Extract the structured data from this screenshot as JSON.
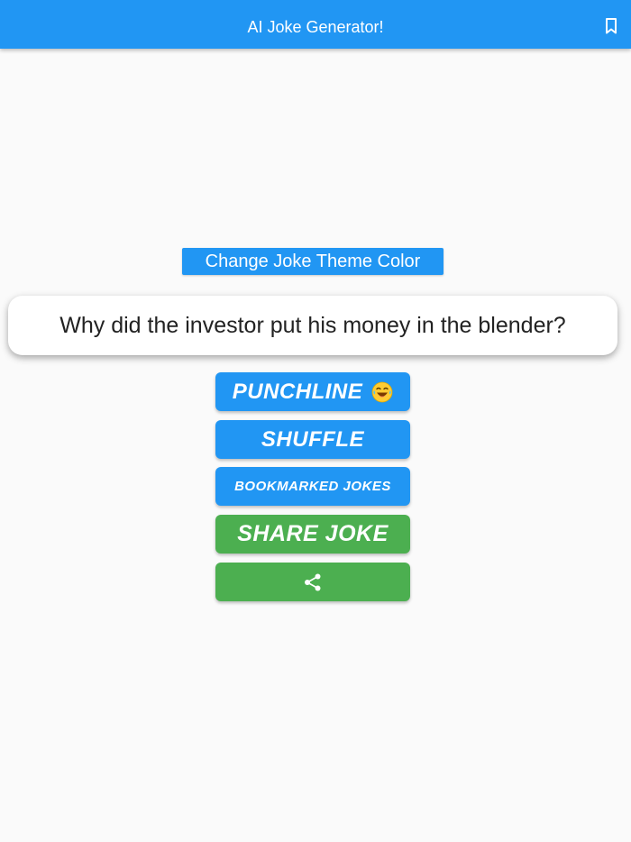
{
  "app_bar": {
    "title": "AI Joke Generator!",
    "bookmark_icon": "bookmark-outline-icon",
    "color": "#2196f3"
  },
  "theme_button": {
    "label": "Change Joke Theme Color"
  },
  "joke": {
    "setup": "Why did the investor put his money in the blender?"
  },
  "actions": {
    "punchline_label": "Punchline",
    "punchline_emoji_icon": "laughing-tears-emoji-icon",
    "shuffle_label": "Shuffle",
    "bookmarked_label": "Bookmarked Jokes",
    "share_joke_label": "Share Joke",
    "share_icon": "share-icon"
  },
  "colors": {
    "primary": "#2196f3",
    "share": "#4caf50",
    "background": "#fafafa"
  }
}
